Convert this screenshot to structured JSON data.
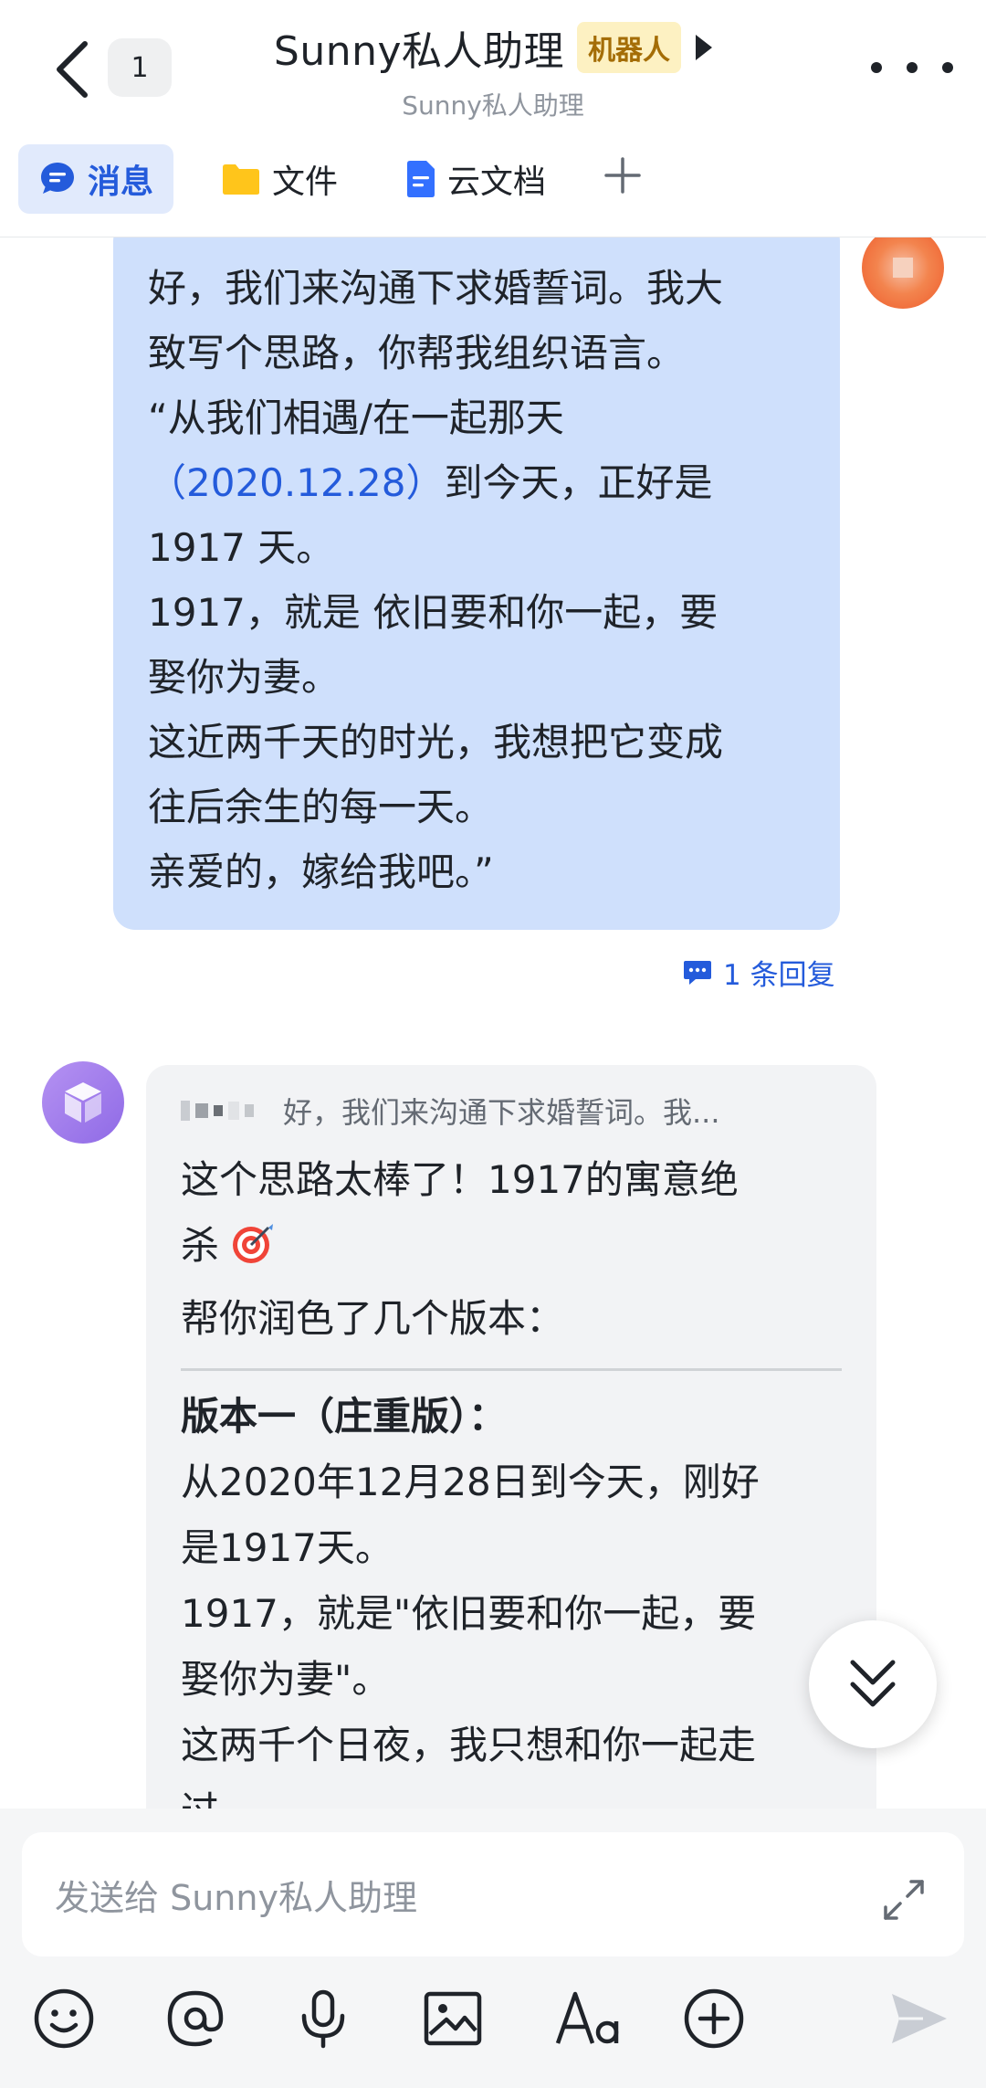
{
  "header": {
    "unread_count": "1",
    "title": "Sunny私人助理",
    "bot_tag": "机器人",
    "subtitle": "Sunny私人助理"
  },
  "tabs": [
    {
      "label": "消息",
      "icon": "chat-icon",
      "active": true
    },
    {
      "label": "文件",
      "icon": "folder-icon",
      "active": false
    },
    {
      "label": "云文档",
      "icon": "doc-icon",
      "active": false
    }
  ],
  "colors": {
    "accent": "#245bdb",
    "my_bubble": "#cfe0fc",
    "bot_bubble": "#f2f3f5",
    "bot_tag_bg": "#fdf1c2",
    "bot_tag_text": "#a46d06"
  },
  "my_message": {
    "lines": [
      "好，我们来沟通下求婚誓词。我大",
      "致写个思路，你帮我组织语言。",
      "“从我们相遇/在一起那天",
      "到今天，正好是",
      "1917 天。",
      "1917，就是 依旧要和你一起，要",
      "娶你为妻。",
      "这近两千天的时光，我想把它变成",
      "往后余生的每一天。",
      "亲爱的，嫁给我吧。”"
    ],
    "date_link": "（2020.12.28）"
  },
  "reply_count": "1 条回复",
  "bot_message": {
    "quote": "好，我们来沟通下求婚誓词。我...",
    "intro_lines": [
      "这个思路太棒了！1917的寓意绝",
      "杀",
      "帮你润色了几个版本："
    ],
    "version_title": "版本一（庄重版）：",
    "version_lines": [
      "从2020年12月28日到今天，刚好",
      "是1917天。",
      "1917，就是\"依旧要和你一起，要",
      "娶你为妻\"。",
      "这两千个日夜，我只想和你一起走",
      "过"
    ]
  },
  "input": {
    "placeholder": "发送给 Sunny私人助理"
  },
  "toolbar_icons": [
    "emoji-icon",
    "mention-icon",
    "microphone-icon",
    "image-icon",
    "text-format-icon",
    "add-circle-icon",
    "send-icon"
  ]
}
